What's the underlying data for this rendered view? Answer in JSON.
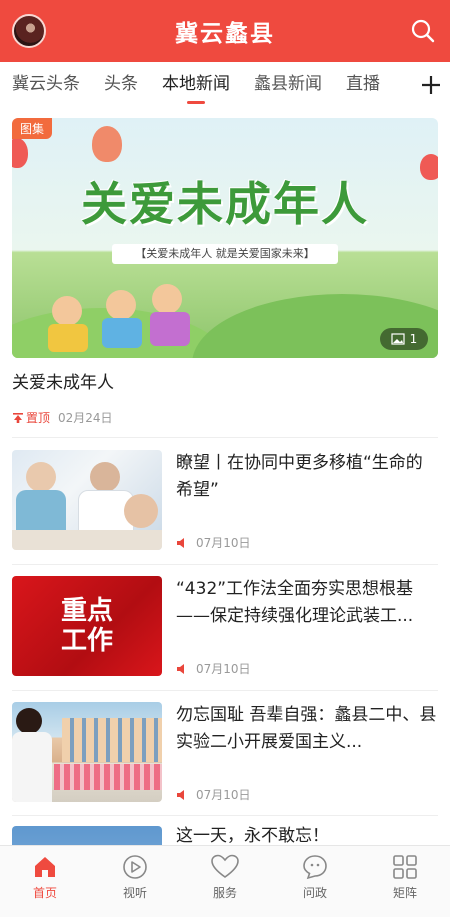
{
  "header": {
    "title": "冀云蠡县"
  },
  "tabs": [
    {
      "label": "冀云头条"
    },
    {
      "label": "头条"
    },
    {
      "label": "本地新闻"
    },
    {
      "label": "蠡县新闻"
    },
    {
      "label": "直播"
    }
  ],
  "active_tab": "本地新闻",
  "feature": {
    "badge": "图集",
    "banner_headline": "关爱未成年人",
    "banner_subline": "【关爱未成年人  就是关爱国家未来】",
    "image_count": "1",
    "title": "关爱未成年人",
    "pinned_label": "置顶",
    "date": "02月24日"
  },
  "articles": [
    {
      "title": "瞭望丨在协同中更多移植“生命的希望”",
      "date": "07月10日",
      "thumb": "doctors"
    },
    {
      "title": "“432”工作法全面夯实思想根基——保定持续强化理论武装工...",
      "date": "07月10日",
      "thumb": "key-work",
      "thumb_text_line1": "重点",
      "thumb_text_line2": "工作"
    },
    {
      "title": "勿忘国耻 吾辈自强：蠡县二中、县实验二小开展爱国主义...",
      "date": "07月10日",
      "thumb": "school"
    },
    {
      "title": "这一天，永不敢忘！",
      "thumb": "sky"
    }
  ],
  "bottom_nav": [
    {
      "label": "首页",
      "icon": "home-icon",
      "active": true
    },
    {
      "label": "视听",
      "icon": "play-icon",
      "active": false
    },
    {
      "label": "服务",
      "icon": "heart-icon",
      "active": false
    },
    {
      "label": "问政",
      "icon": "chat-icon",
      "active": false
    },
    {
      "label": "矩阵",
      "icon": "grid-icon",
      "active": false
    }
  ],
  "colors": {
    "brand": "#ef4a3f",
    "muted": "#999999"
  }
}
